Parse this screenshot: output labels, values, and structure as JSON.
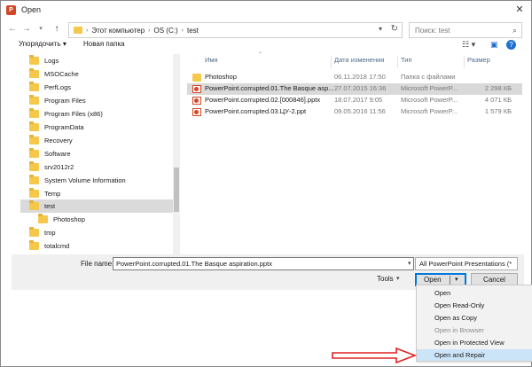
{
  "window": {
    "title": "Open"
  },
  "nav": {
    "breadcrumb": [
      "Этот компьютер",
      "OS (C:)",
      "test"
    ],
    "search_placeholder": "Поиск: test"
  },
  "toolbar": {
    "organize": "Упорядочить",
    "new_folder": "Новая папка"
  },
  "tree": {
    "items": [
      {
        "label": "Logs"
      },
      {
        "label": "MSOCache"
      },
      {
        "label": "PerfLogs"
      },
      {
        "label": "Program Files"
      },
      {
        "label": "Program Files (x86)"
      },
      {
        "label": "ProgramData"
      },
      {
        "label": "Recovery"
      },
      {
        "label": "Software"
      },
      {
        "label": "srv2012r2"
      },
      {
        "label": "System Volume Information"
      },
      {
        "label": "Temp"
      },
      {
        "label": "test",
        "selected": true
      },
      {
        "label": "Photoshop",
        "child": true
      },
      {
        "label": "tmp"
      },
      {
        "label": "totalcmd"
      }
    ]
  },
  "list": {
    "columns": {
      "name": "Имя",
      "date": "Дата изменения",
      "type": "Тип",
      "size": "Размер"
    },
    "rows": [
      {
        "icon": "folder-icon",
        "name": "Photoshop",
        "date": "06.11.2018 17:50",
        "type": "Папка с файлами",
        "size": ""
      },
      {
        "icon": "powerpoint-file-icon",
        "name": "PowerPoint.corrupted.01.The Basque asp...",
        "date": "27.07.2015 16:36",
        "type": "Microsoft PowerP...",
        "size": "2 298 КБ",
        "selected": true
      },
      {
        "icon": "powerpoint-file-icon",
        "name": "PowerPoint.corrupted.02.[000846].pptx",
        "date": "18.07.2017 9:05",
        "type": "Microsoft PowerP...",
        "size": "4 071 КБ"
      },
      {
        "icon": "powerpoint-file-icon",
        "name": "PowerPoint.corrupted.03.ЦУ-2.ppt",
        "date": "09.05.2016 11:56",
        "type": "Microsoft PowerP...",
        "size": "1 579 КБ"
      }
    ]
  },
  "bottom": {
    "file_name_label": "File name:",
    "file_name_value": "PowerPoint.corrupted.01.The Basque aspiration.pptx",
    "file_type": "All PowerPoint Presentations (*",
    "tools": "Tools",
    "open": "Open",
    "cancel": "Cancel"
  },
  "open_menu": {
    "items": [
      {
        "label": "Open",
        "disabled": false
      },
      {
        "label": "Open Read-Only",
        "disabled": false
      },
      {
        "label": "Open as Copy",
        "disabled": false
      },
      {
        "label": "Open in Browser",
        "disabled": true
      },
      {
        "label": "Open in Protected View",
        "disabled": false
      },
      {
        "label": "Open and Repair",
        "disabled": false,
        "highlighted": true
      }
    ]
  },
  "colors": {
    "accent": "#0078d7",
    "highlight": "#cce4f7",
    "annotation": "#e02020",
    "folder": "#f5c84c"
  }
}
